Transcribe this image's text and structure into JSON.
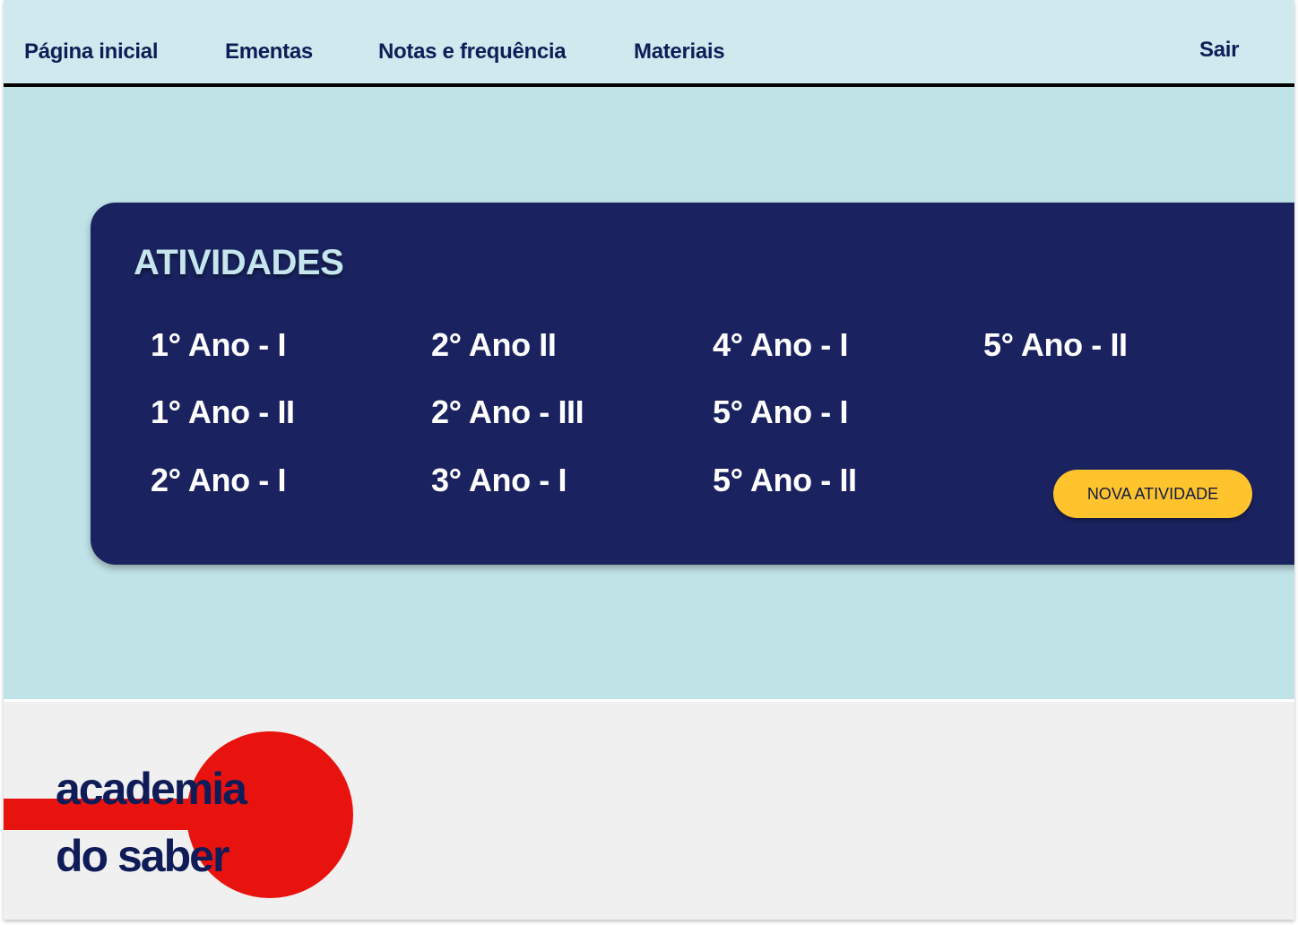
{
  "nav": {
    "home": "Página inicial",
    "menus": "Ementas",
    "grades": "Notas e frequência",
    "materials": "Materiais",
    "logout": "Sair"
  },
  "activities": {
    "title": "ATIVIDADES",
    "classes": [
      "1° Ano - I",
      "1° Ano - II",
      "2° Ano - I",
      "2° Ano II",
      "2° Ano - III",
      "3° Ano - I",
      "4° Ano - I",
      "5° Ano - I",
      "5° Ano - II",
      "5° Ano - II"
    ],
    "new_button": "NOVA ATIVIDADE"
  },
  "footer": {
    "logo_line1": "academia",
    "logo_line2": "do saber"
  },
  "colors": {
    "nav_bg": "#cfeaee",
    "main_bg": "#c0e3e7",
    "panel_bg": "#1a2360",
    "accent_button": "#fec32d",
    "logo_red": "#e8130e",
    "text_dark": "#0f1d57"
  }
}
